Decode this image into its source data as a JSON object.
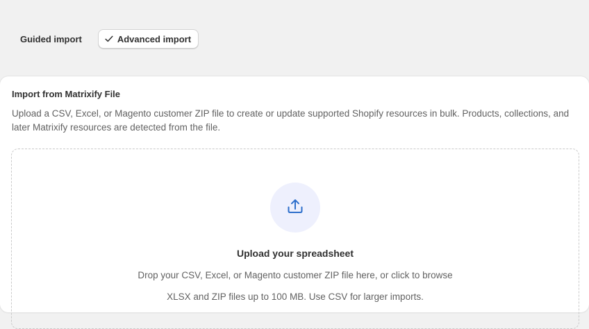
{
  "tabs": {
    "guided_label": "Guided import",
    "advanced_label": "Advanced import",
    "active": "advanced"
  },
  "card": {
    "title": "Import from Matrixify File",
    "description": "Upload a CSV, Excel, or Magento customer ZIP file to create or update supported Shopify resources in bulk. Products, collections, and later Matrixify resources are detected from the file."
  },
  "dropzone": {
    "icon": "upload-icon",
    "title": "Upload your spreadsheet",
    "subtitle": "Drop your CSV, Excel, or Magento customer ZIP file here, or click to browse",
    "note": "XLSX and ZIP files up to 100 MB. Use CSV for larger imports."
  },
  "colors": {
    "page_bg": "#f1f1f1",
    "card_bg": "#ffffff",
    "icon_accent": "#2c6ecb",
    "icon_bg": "#eef0fd",
    "muted_text": "#616161"
  }
}
